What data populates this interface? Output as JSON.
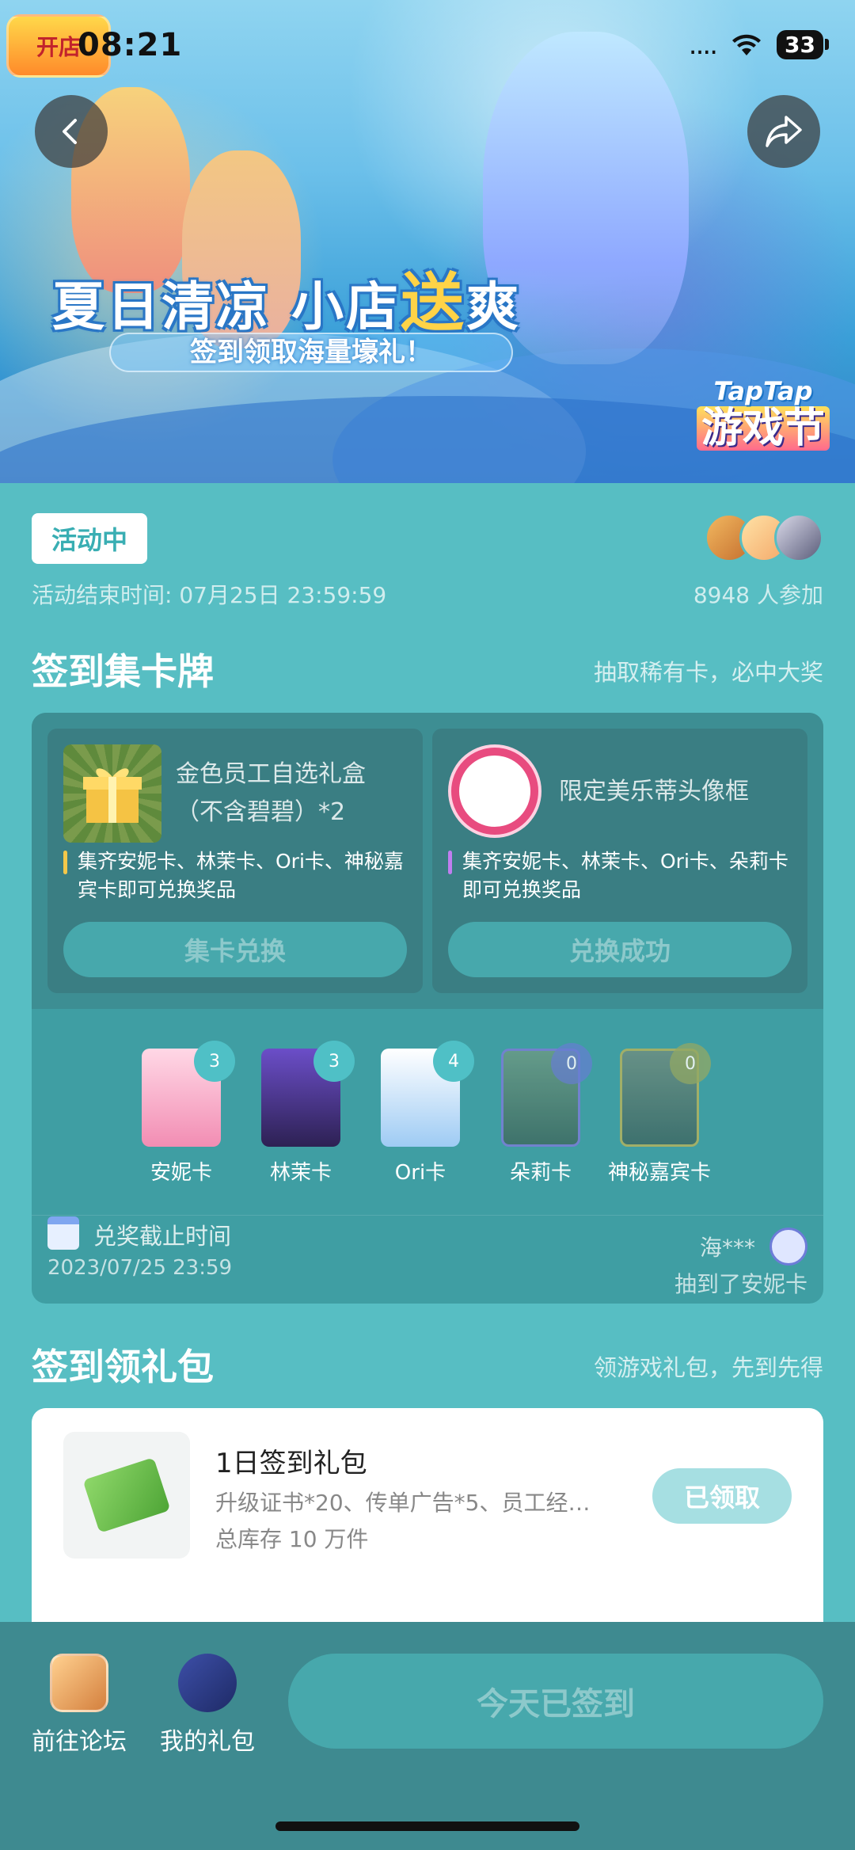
{
  "status_bar": {
    "time": "08:21",
    "battery": "33"
  },
  "banner": {
    "title_part1": "夏日清凉 小店",
    "title_highlight": "送",
    "title_part2": "爽",
    "subtitle": "签到领取海量壕礼！",
    "brand_top": "TapTap",
    "brand_bottom": "游戏节"
  },
  "activity": {
    "status": "活动中",
    "end_time": "活动结束时间: 07月25日 23:59:59",
    "participants": "8948 人参加"
  },
  "card_section": {
    "title": "签到集卡牌",
    "note": "抽取稀有卡，必中大奖",
    "rewards": [
      {
        "name": "金色员工自选礼盒（不含碧碧）*2",
        "desc": "集齐安妮卡、林茉卡、Ori卡、神秘嘉宾卡即可兑换奖品",
        "button": "集卡兑换"
      },
      {
        "name": "限定美乐蒂头像框",
        "desc": "集齐安妮卡、林茉卡、Ori卡、朵莉卡即可兑换奖品",
        "button": "兑换成功"
      }
    ],
    "cards": [
      {
        "label": "安妮卡",
        "count": "3"
      },
      {
        "label": "林茉卡",
        "count": "3"
      },
      {
        "label": "Ori卡",
        "count": "4"
      },
      {
        "label": "朵莉卡",
        "count": "0"
      },
      {
        "label": "神秘嘉宾卡",
        "count": "0"
      }
    ],
    "deadline_label": "兑奖截止时间",
    "deadline_date": "2023/07/25 23:59",
    "ticker_name": "海***",
    "ticker_text": "抽到了安妮卡"
  },
  "gift_section": {
    "title": "签到领礼包",
    "note": "领游戏礼包，先到先得",
    "packs": [
      {
        "name": "1日签到礼包",
        "desc": "升级证书*20、传单广告*5、员工经…",
        "stock": "总库存 10 万件",
        "button": "已领取"
      }
    ]
  },
  "bottom_bar": {
    "forum_label": "前往论坛",
    "gift_label": "我的礼包",
    "checkin_label": "今天已签到"
  },
  "colors": {
    "page_bg": "#57bec3",
    "panel_bg": "#3f9ea3",
    "bottom_bar": "#3e8a90",
    "accent_teal": "#39aeb3"
  },
  "icons": {
    "back": "chevron-left-icon",
    "share": "share-arrow-icon",
    "calendar": "calendar-icon",
    "wifi": "wifi-icon"
  }
}
